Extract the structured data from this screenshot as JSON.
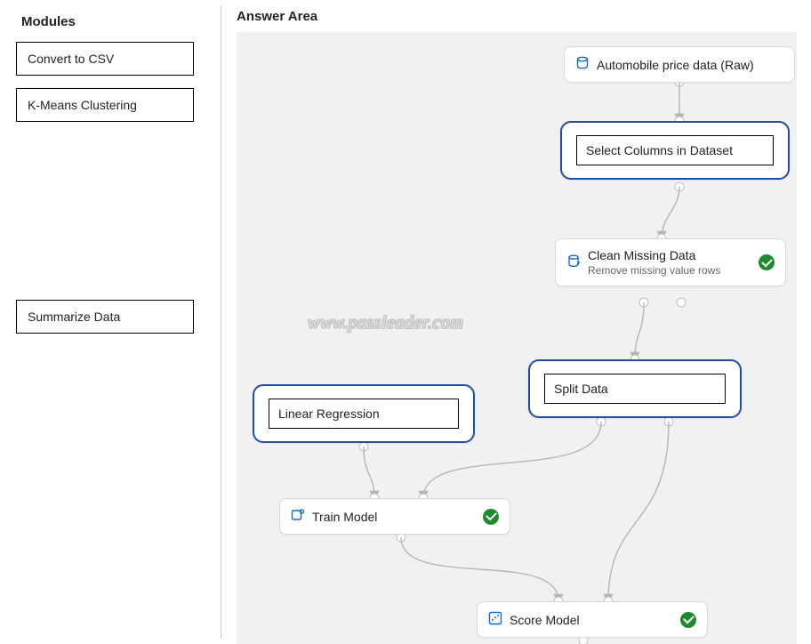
{
  "left": {
    "title": "Modules",
    "items": [
      {
        "label": "Convert to CSV"
      },
      {
        "label": "K-Means Clustering"
      },
      {
        "label": "Summarize Data"
      }
    ]
  },
  "right": {
    "title": "Answer Area"
  },
  "nodes": {
    "raw": {
      "label": "Automobile price data (Raw)",
      "icon": "database-icon"
    },
    "selectcols": {
      "label": "Select Columns in Dataset"
    },
    "clean": {
      "label": "Clean Missing Data",
      "sub": "Remove missing value rows",
      "icon": "clean-data-icon",
      "status": "success"
    },
    "split": {
      "label": "Split Data"
    },
    "linreg": {
      "label": "Linear Regression"
    },
    "train": {
      "label": "Train Model",
      "icon": "train-model-icon",
      "status": "success"
    },
    "score": {
      "label": "Score Model",
      "icon": "score-model-icon",
      "status": "success"
    }
  },
  "watermark": "www.passleader.com"
}
